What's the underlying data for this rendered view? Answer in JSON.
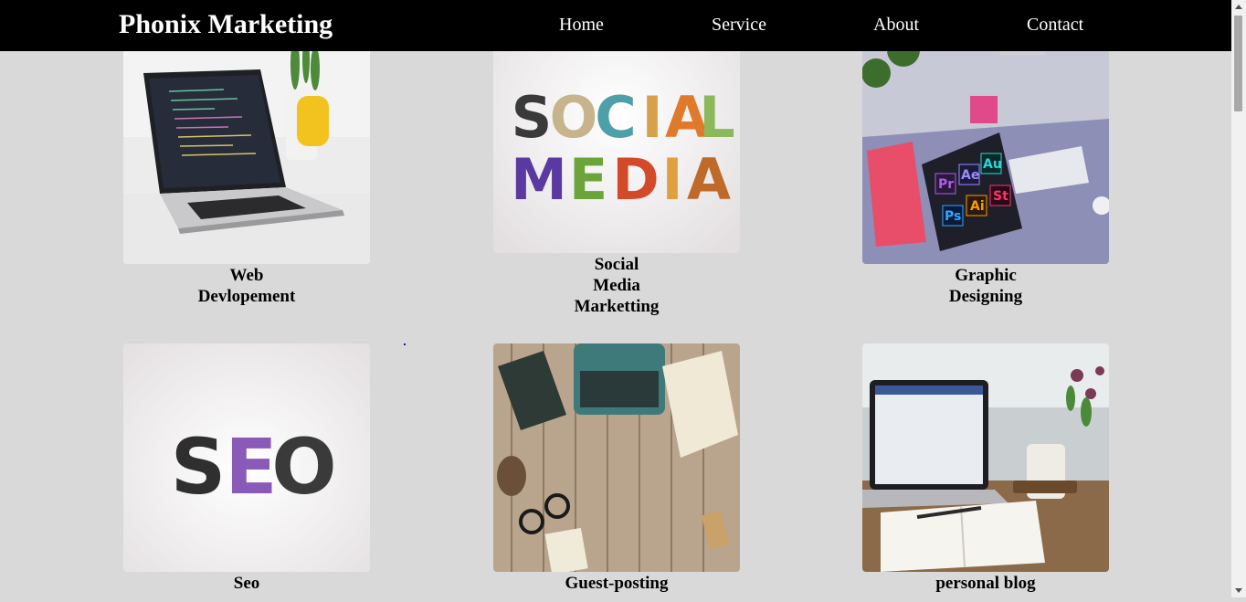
{
  "header": {
    "brand": "Phonix Marketing",
    "nav": [
      {
        "label": "Home"
      },
      {
        "label": "Service"
      },
      {
        "label": "About"
      },
      {
        "label": "Contact"
      }
    ]
  },
  "services": [
    {
      "title_lines": [
        "Web",
        "Devlopement"
      ],
      "image": "laptop-code-photo"
    },
    {
      "title_lines": [
        "Social",
        "Media",
        "Marketting"
      ],
      "image": "social-media-letters-photo"
    },
    {
      "title_lines": [
        "Graphic",
        "Designing"
      ],
      "image": "adobe-apps-tablet-photo"
    },
    {
      "title_lines": [
        "Seo"
      ],
      "image": "seo-letters-photo"
    },
    {
      "title_lines": [
        "Guest-posting"
      ],
      "image": "typewriter-desk-photo"
    },
    {
      "title_lines": [
        "personal blog"
      ],
      "image": "laptop-notebook-photo"
    }
  ],
  "colors": {
    "navbar": "#000000",
    "page_background": "#d9d9d9",
    "text": "#000000",
    "nav_text": "#ffffff"
  }
}
